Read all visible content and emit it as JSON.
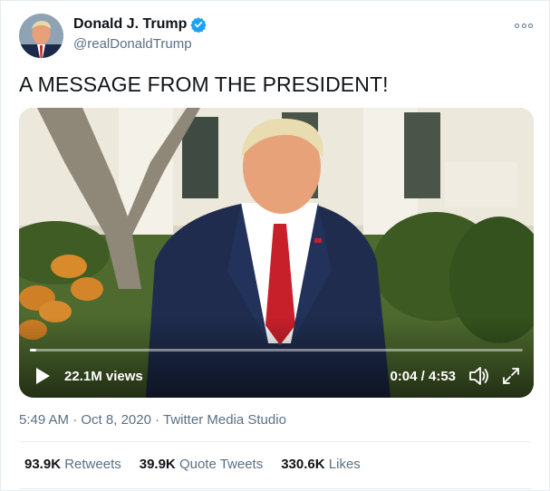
{
  "author": {
    "display_name": "Donald J. Trump",
    "handle": "@realDonaldTrump",
    "verified": true,
    "avatar_icon": "profile-photo"
  },
  "tweet": {
    "text": "A MESSAGE FROM THE PRESIDENT!"
  },
  "video": {
    "views": "22.1M views",
    "time": "0:04 / 4:53",
    "progress_fraction": 0.0137,
    "play_icon": "play-icon",
    "volume_icon": "volume-icon",
    "fullscreen_icon": "fullscreen-icon"
  },
  "meta": {
    "time": "5:49 AM",
    "date": "Oct 8, 2020",
    "source": "Twitter Media Studio",
    "separator": " · "
  },
  "stats": [
    {
      "count": "93.9K",
      "label": "Retweets"
    },
    {
      "count": "39.9K",
      "label": "Quote Tweets"
    },
    {
      "count": "330.6K",
      "label": "Likes"
    }
  ],
  "colors": {
    "verified_blue": "#1da1f2",
    "secondary_text": "#5b7083",
    "primary_text": "#0f1419",
    "divider": "#e6ecf0"
  }
}
